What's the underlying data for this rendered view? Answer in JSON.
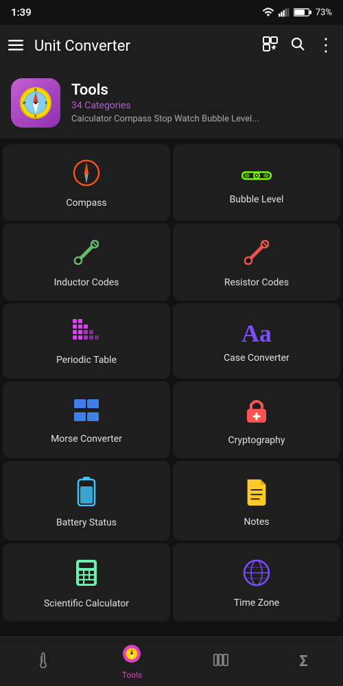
{
  "statusBar": {
    "time": "1:39",
    "battery": "73%"
  },
  "appBar": {
    "menuIcon": "≡",
    "title": "Unit Converter",
    "gridStarIcon": "⊞★",
    "searchIcon": "🔍",
    "moreIcon": "⋮"
  },
  "header": {
    "title": "Tools",
    "categoryCount": "34 Categories",
    "description": "Calculator Compass Stop Watch Bubble Level..."
  },
  "grid": {
    "items": [
      {
        "id": "compass",
        "label": "Compass",
        "iconClass": "icon-compass",
        "icon": "🧭"
      },
      {
        "id": "bubble-level",
        "label": "Bubble Level",
        "iconClass": "icon-bubble",
        "icon": "▬▬▬"
      },
      {
        "id": "inductor-codes",
        "label": "Inductor Codes",
        "iconClass": "icon-inductor",
        "icon": "✏"
      },
      {
        "id": "resistor-codes",
        "label": "Resistor Codes",
        "iconClass": "icon-resistor",
        "icon": "✏"
      },
      {
        "id": "periodic-table",
        "label": "Periodic Table",
        "iconClass": "icon-periodic",
        "icon": "⣿"
      },
      {
        "id": "case-converter",
        "label": "Case Converter",
        "iconClass": "icon-case",
        "icon": "Aa"
      },
      {
        "id": "morse-converter",
        "label": "Morse Converter",
        "iconClass": "icon-morse",
        "icon": "⊞"
      },
      {
        "id": "cryptography",
        "label": "Cryptography",
        "iconClass": "icon-crypto",
        "icon": "🔒"
      },
      {
        "id": "battery-status",
        "label": "Battery Status",
        "iconClass": "icon-battery",
        "icon": "🔋"
      },
      {
        "id": "notes",
        "label": "Notes",
        "iconClass": "icon-notes",
        "icon": "📄"
      },
      {
        "id": "scientific-calculator",
        "label": "Scientific Calculator",
        "iconClass": "icon-calculator",
        "icon": "🔢"
      },
      {
        "id": "time-zone",
        "label": "Time Zone",
        "iconClass": "icon-timezone",
        "icon": "🌐"
      }
    ]
  },
  "bottomNav": {
    "items": [
      {
        "id": "temperature",
        "label": "",
        "icon": "🌡",
        "active": false
      },
      {
        "id": "tools",
        "label": "Tools",
        "icon": "🧭",
        "active": true
      },
      {
        "id": "collections",
        "label": "",
        "icon": "⊞",
        "active": false
      },
      {
        "id": "sigma",
        "label": "",
        "icon": "Σ",
        "active": false
      }
    ]
  }
}
